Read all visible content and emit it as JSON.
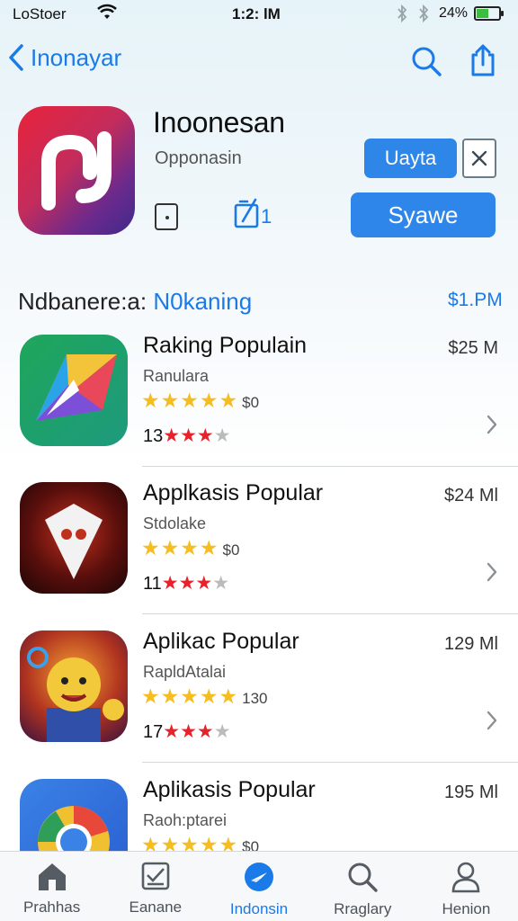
{
  "status_bar": {
    "carrier": "LoStoer",
    "time": "1:2: lM",
    "battery": "24%",
    "battery_level": 0.55
  },
  "nav": {
    "back_label": "Inonayar"
  },
  "app": {
    "title": "Inoonesan",
    "subtitle": "Opponasin",
    "primary_small_label": "Uayta",
    "primary_large_label": "Syawe",
    "meta_count": "1"
  },
  "section": {
    "title_prefix": "Ndbanere:a:",
    "title_accent": "N0kaning",
    "link": "$1.PM"
  },
  "apps": [
    {
      "name": "Raking Populain",
      "subtitle": "Ranulara",
      "rating_stars": 4.5,
      "rating_count": "$0",
      "reviews_prefix": "13",
      "reviews_stars": 3,
      "price": "$25 M"
    },
    {
      "name": "Applkasis Popular",
      "subtitle": "Stdolake",
      "rating_stars": 4,
      "rating_count": "$0",
      "reviews_prefix": "11",
      "reviews_stars": 3,
      "price": "$24 Ml"
    },
    {
      "name": "Aplikac Popular",
      "subtitle": "RapldAtalai",
      "rating_stars": 5,
      "rating_count": "130",
      "reviews_prefix": "17",
      "reviews_stars": 3,
      "price": "129 Ml"
    },
    {
      "name": "Aplikasis Popular",
      "subtitle": "Raoh:ptarei",
      "rating_stars": 5,
      "rating_count": "$0",
      "reviews_prefix": "",
      "reviews_stars": 0,
      "price": "195 Ml"
    }
  ],
  "tabs": [
    {
      "label": "Prahhas",
      "icon": "home-icon"
    },
    {
      "label": "Eanane",
      "icon": "checklist-icon"
    },
    {
      "label": "Indonsin",
      "icon": "compass-icon",
      "active": true
    },
    {
      "label": "Rraglary",
      "icon": "search-icon"
    },
    {
      "label": "Henion",
      "icon": "person-icon"
    }
  ],
  "colors": {
    "accent": "#1a7ae8",
    "star": "#f5bd1f",
    "review_star": "#e8212b"
  }
}
